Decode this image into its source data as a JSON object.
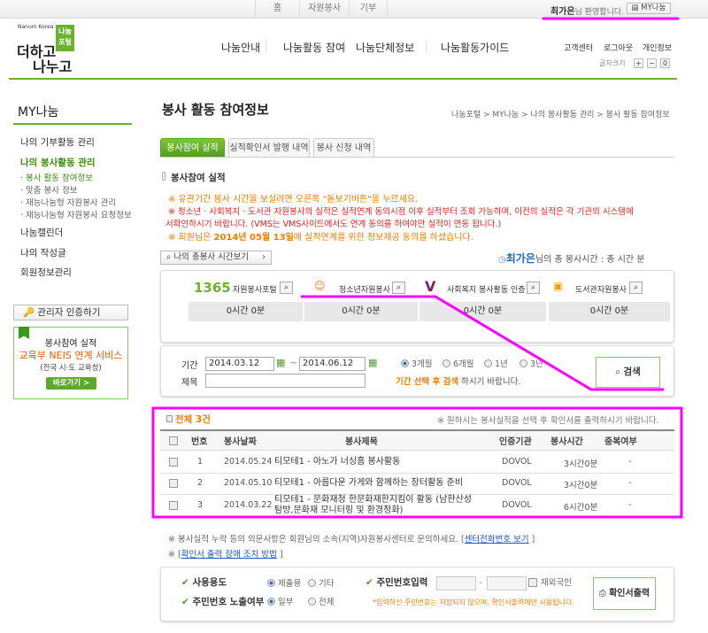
{
  "topbar": {
    "nav": [
      "홈",
      "자원봉사",
      "기부"
    ],
    "user_name": "최가은",
    "welcome": "님 환영합니다.",
    "my_button": "MY나눔"
  },
  "logo": {
    "small": "Nanum Korea",
    "badge": "나눔 포털",
    "line1": "더하고",
    "line2": "나누고"
  },
  "main_nav": [
    "나눔안내",
    "나눔활동 참여",
    "나눔단체정보",
    "나눔활동가이드"
  ],
  "util_links": [
    "고객센터",
    "로그아웃",
    "개인정보"
  ],
  "font_size": {
    "label": "글자크기",
    "buttons": [
      "+",
      "−",
      "0"
    ]
  },
  "sidebar": {
    "title": "MY나눔",
    "items": [
      {
        "label": "나의 기부활동 관리"
      },
      {
        "label": "나의 봉사활동 관리",
        "active": true
      }
    ],
    "subitems": [
      "· 봉사 활동 참여정보",
      "· 맞춤 봉사 정보",
      "· 재능나눔형 자원봉사 관리",
      "· 재능나눔형 자원봉사 요청정보"
    ],
    "items2": [
      "나눔캘린더",
      "나의 작성글",
      "회원정보관리"
    ],
    "admin_button": "관리자 인증하기",
    "neis": {
      "title": "봉사참여 실적",
      "service": "교육부 NEIS 연계 서비스",
      "sub": "(전국 시·도 교육청)",
      "button": "바로가기 >"
    }
  },
  "page": {
    "title": "봉사 활동 참여정보",
    "breadcrumb": "나눔포털 > MY나눔 > 나의 봉사활동 관리 > 봉사 활동 참여정보"
  },
  "tabs": [
    "봉사참여 실적",
    "실적확인서 발행 내역",
    "봉사 신청 내역"
  ],
  "section_title": "봉사참여 실적",
  "notices": [
    "※ 유관기간 봉사 시간을 보실려면 오른쪽 \"돋보기버튼\"을 누르세요.",
    "※ 청소년 · 사회복지 · 도서관 자원봉사의 실적은 실적연계 동의시점 이후 실적부터 조회 가능하며, 이전의 실적은 각 기관의 시스템에",
    "서확인하시기 바랍니다. (VMS는 VMS사이트에서도 연계 동의를 하여야만 실적이 연동 됩니다.)"
  ],
  "consent": {
    "pre": "※ 회원님은 ",
    "date": "2014년 05월 13일",
    "post": "에 실적연계를 위한 정보제공 동의를 하셨습니다."
  },
  "total_button": "나의 총봉사 시간보기",
  "total": {
    "name": "최가은",
    "text": "님의 총 봉사시간 :  총 시간 분"
  },
  "portals": [
    {
      "logo": "1365",
      "label": "자원봉사포털",
      "value": "0시간 0분"
    },
    {
      "label": "청소년자원봉사",
      "value": "0시간 0분"
    },
    {
      "label": "사회복지 봉사활동 인증",
      "value": "0시간 0분"
    },
    {
      "label": "도서관자원봉사",
      "value": "0시간 0분"
    }
  ],
  "search": {
    "period_label": "기간",
    "from": "2014.03.12",
    "to": "2014.06.12",
    "title_label": "제목",
    "title_value": "",
    "ranges": [
      "3개월",
      "6개월",
      "1년",
      "3년"
    ],
    "hint_em": "기간 선택 후 검색",
    "hint": " 하시기 바랍니다.",
    "button": "검색"
  },
  "list": {
    "total": "전체 3건",
    "note": "※ 원하시는 봉사실적을 선택 후 확인서를 출력하시기 바랍니다.",
    "headers": [
      "번호",
      "봉사날짜",
      "봉사제목",
      "인증기관",
      "봉사시간",
      "중복여부"
    ],
    "rows": [
      {
        "no": "1",
        "date": "2014.05.24",
        "title": "티모테1 - 아노가 너싱홈 봉사활동",
        "title2": "",
        "org": "DOVOL",
        "time": "3시간0분",
        "dup": "-"
      },
      {
        "no": "2",
        "date": "2014.05.10",
        "title": "티모테1 - 아름다운 가게와 함께하는 장터활동 준비",
        "title2": "",
        "org": "DOVOL",
        "time": "3시간0분",
        "dup": "-"
      },
      {
        "no": "3",
        "date": "2014.03.22",
        "title": "티모테1 - 문화재청 한문화재한지킴이 활동 (남한산성",
        "title2": "탐방,문화재 모니터링 및 환경정화)",
        "org": "DOVOL",
        "time": "6시간0분",
        "dup": "-"
      }
    ]
  },
  "footer_notes": {
    "n1": "※ 봉사실적 누락 등의 의문사항은 회원님의 소속(지역)자원봉사센터로 문의하세요. [",
    "n1_link": "센터전화번호 보기",
    "close": " ]",
    "n2": "※ [",
    "n2_link": "확인서 출력 장애 조치 방법"
  },
  "print": {
    "usage_label": "사용용도",
    "usage_opts": [
      "제출용",
      "기타"
    ],
    "expose_label": "주민번호 노출여부",
    "expose_opts": [
      "일부",
      "전체"
    ],
    "rrn_label": "주민번호입력",
    "dash": "-",
    "foreigner": "재외국인",
    "hint": "*입력하신 주민번호는 저장되지 않으며, 확인서출력에만 사용됩니다.",
    "button": "확인서출력"
  },
  "colors": {
    "green": "#6ab42d",
    "orange": "#f07d00",
    "red": "#e8201b",
    "annotation": "#ff00ff"
  }
}
